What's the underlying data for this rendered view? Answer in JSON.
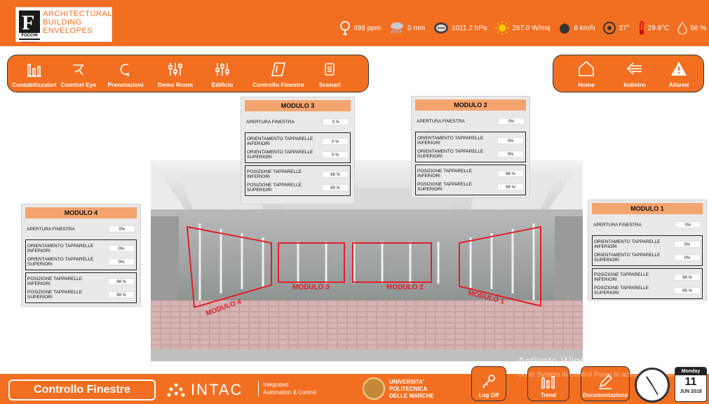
{
  "logo": {
    "brand": "FOCCHI",
    "since": "SINCE 1914",
    "line1": "ARCHITECTURAL",
    "line2": "BUILDING",
    "line3": "ENVELOPES"
  },
  "sensors": [
    {
      "icon": "tree-icon",
      "value": "498 ppm"
    },
    {
      "icon": "rain-icon",
      "value": "0 mm"
    },
    {
      "icon": "pressure-gauge-icon",
      "value": "1011.2 hPa"
    },
    {
      "icon": "sun-icon",
      "value": "267.0 W/mq"
    },
    {
      "icon": "wind-icon",
      "value": "8 km/h"
    },
    {
      "icon": "compass-icon",
      "value": "37°"
    },
    {
      "icon": "thermometer-icon",
      "value": "29.9°C"
    },
    {
      "icon": "humidity-drop-icon",
      "value": "56 %"
    }
  ],
  "nav_left": [
    {
      "icon": "meter-icon",
      "label": "Contabilizzatori"
    },
    {
      "icon": "comfort-eye-icon",
      "label": "Comfort Eye"
    },
    {
      "icon": "booking-icon",
      "label": "Prenotazioni"
    },
    {
      "icon": "sliders-icon",
      "label": "Demo Room"
    },
    {
      "icon": "building-sliders-icon",
      "label": "Edificio"
    },
    {
      "icon": "window-icon",
      "label": "Controllo Finestre"
    },
    {
      "icon": "scenari-icon",
      "label": "Scenari"
    }
  ],
  "nav_right": [
    {
      "icon": "home-icon",
      "label": "Home"
    },
    {
      "icon": "back-arrow-icon",
      "label": "Indietro"
    },
    {
      "icon": "alarm-icon",
      "label": "Allarmi"
    }
  ],
  "labels": {
    "apertura": "APERTURA FINESTRA",
    "or_inf": "ORIENTAMENTO TAPPARELLE INFERIORI",
    "or_sup": "ORIENTAMENTO TAPPARELLE SUPERIORI",
    "pos_inf": "POSIZIONE TAPPARELLE INFERIORI",
    "pos_sup": "POSIZIONE TAPPARELLE SUPERIORI"
  },
  "modules": {
    "m1": {
      "title": "MODULO 1",
      "apertura": "0%",
      "or_inf": "0%",
      "or_sup": "0%",
      "pos_inf": "98 %",
      "pos_sup": "99 %"
    },
    "m2": {
      "title": "MODULO 2",
      "apertura": "0%",
      "or_inf": "0%",
      "or_sup": "0%",
      "pos_inf": "98 %",
      "pos_sup": "99 %"
    },
    "m3": {
      "title": "MODULO 3",
      "apertura": "0 %",
      "or_inf": "0 %",
      "or_sup": "0 %",
      "pos_inf": "98 %",
      "pos_sup": "99 %"
    },
    "m4": {
      "title": "MODULO 4",
      "apertura": "0%",
      "or_inf": "0%",
      "or_sup": "0%",
      "pos_inf": "98 %",
      "pos_sup": "99 %"
    }
  },
  "room_labels": {
    "m1": "MODULO 1",
    "m2": "MODULO 2",
    "m3": "MODULO 3",
    "m4": "MODULO 4"
  },
  "footer": {
    "page": "Controllo Finestre",
    "intac": "INTAC",
    "intac_sub1": "Integrated",
    "intac_sub2": "Automation & Control",
    "univ1": "UNIVERSITA'",
    "univ2": "POLITECNICA",
    "univ3": "DELLE MARCHE",
    "logoff": "Log Off",
    "trend": "Trend",
    "doc": "Documentazione",
    "watermark": "Activate Windows",
    "watermark_sub": "Go to System in Control Panel to activate Windows."
  },
  "calendar": {
    "dow": "Monday",
    "day": "11",
    "month": "JUN 2018"
  },
  "colors": {
    "accent": "#f26f21",
    "panel_title": "#f4a46e",
    "module_outline": "#e0202a"
  }
}
